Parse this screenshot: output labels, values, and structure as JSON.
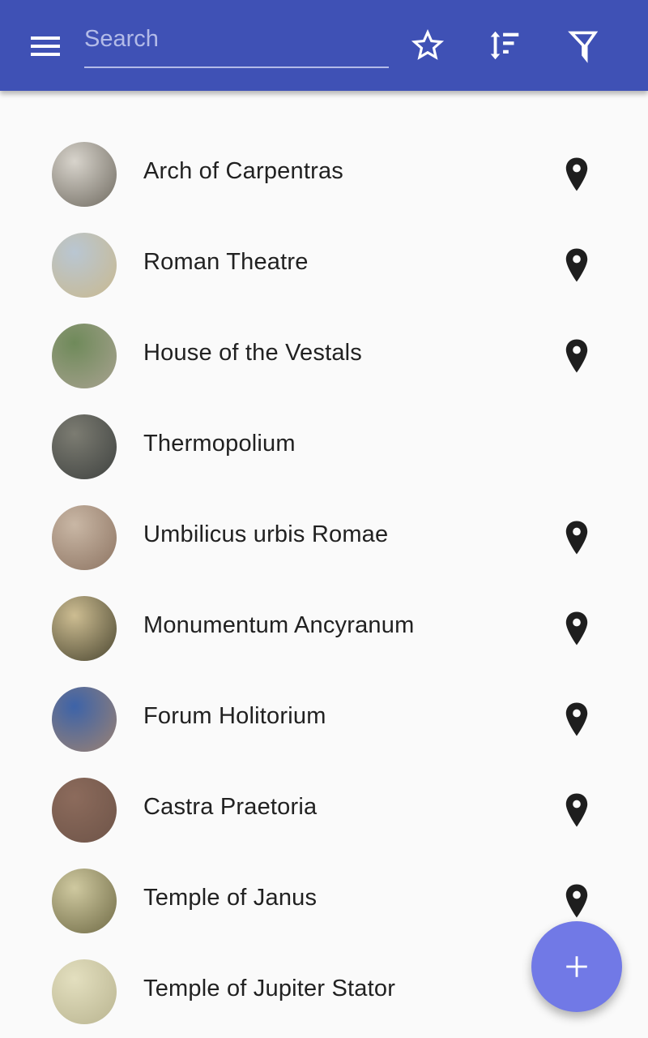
{
  "appbar": {
    "search": {
      "placeholder": "Search",
      "value": ""
    },
    "icons": [
      "menu-icon",
      "star-icon",
      "sort-icon",
      "filter-icon"
    ]
  },
  "colors": {
    "primary": "#3f51b5",
    "fab": "#7179e6",
    "text": "#212121"
  },
  "places": [
    {
      "name": "Arch of Carpentras",
      "has_location": true,
      "thumb": [
        "#d8d4cc",
        "#6f6a60"
      ]
    },
    {
      "name": "Roman Theatre",
      "has_location": true,
      "thumb": [
        "#b9c6d2",
        "#c9b98f"
      ]
    },
    {
      "name": "House of the Vestals",
      "has_location": true,
      "thumb": [
        "#6f8a5a",
        "#a8a290"
      ]
    },
    {
      "name": "Thermopolium",
      "has_location": false,
      "thumb": [
        "#7c7c72",
        "#3f4240"
      ]
    },
    {
      "name": "Umbilicus urbis Romae",
      "has_location": true,
      "thumb": [
        "#c9b7a5",
        "#8d7462"
      ]
    },
    {
      "name": "Monumentum Ancyranum",
      "has_location": true,
      "thumb": [
        "#cdbd92",
        "#4a4630"
      ]
    },
    {
      "name": "Forum Holitorium",
      "has_location": true,
      "thumb": [
        "#3d63a8",
        "#9c8272"
      ]
    },
    {
      "name": "Castra Praetoria",
      "has_location": true,
      "thumb": [
        "#8c6b5c",
        "#6e5448"
      ]
    },
    {
      "name": "Temple of Janus",
      "has_location": true,
      "thumb": [
        "#cfc9a0",
        "#6f6a45"
      ]
    },
    {
      "name": "Temple of Jupiter Stator",
      "has_location": false,
      "thumb": [
        "#e3dfbf",
        "#b9b490"
      ]
    }
  ],
  "fab": {
    "icon": "plus-icon"
  }
}
